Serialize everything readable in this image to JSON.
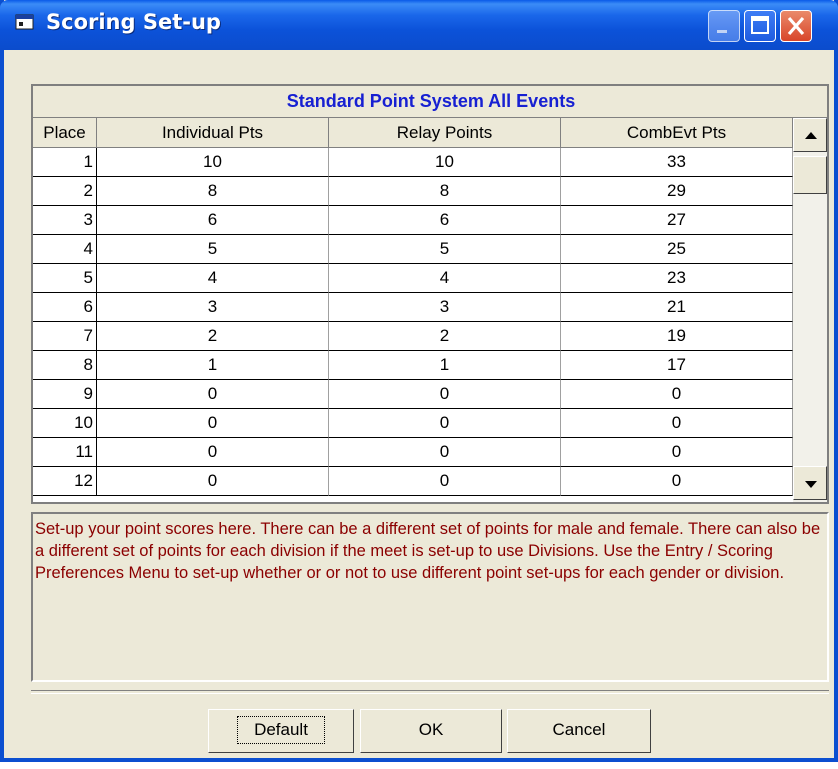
{
  "window": {
    "title": "Scoring Set-up"
  },
  "grid": {
    "caption": "Standard Point System All Events",
    "headers": [
      "Place",
      "Individual Pts",
      "Relay Points",
      "CombEvt Pts"
    ],
    "rows": [
      [
        "1",
        "10",
        "10",
        "33"
      ],
      [
        "2",
        "8",
        "8",
        "29"
      ],
      [
        "3",
        "6",
        "6",
        "27"
      ],
      [
        "4",
        "5",
        "5",
        "25"
      ],
      [
        "5",
        "4",
        "4",
        "23"
      ],
      [
        "6",
        "3",
        "3",
        "21"
      ],
      [
        "7",
        "2",
        "2",
        "19"
      ],
      [
        "8",
        "1",
        "1",
        "17"
      ],
      [
        "9",
        "0",
        "0",
        "0"
      ],
      [
        "10",
        "0",
        "0",
        "0"
      ],
      [
        "11",
        "0",
        "0",
        "0"
      ],
      [
        "12",
        "0",
        "0",
        "0"
      ]
    ]
  },
  "message": "Set-up your point scores here. There can be a different set of points for male and female. There can also be a different set of points for each division if the meet is set-up to use Divisions. Use the Entry / Scoring Preferences Menu to set-up whether or or not to use different point set-ups for each gender or division.",
  "buttons": {
    "default": "Default",
    "ok": "OK",
    "cancel": "Cancel"
  },
  "colors": {
    "title_bar": "#0b4fd0",
    "caption_text": "#1720d2",
    "message_text": "#8b0000",
    "face": "#ece9d8"
  },
  "icons": [
    "app-window-icon",
    "minimize-icon",
    "maximize-icon",
    "close-icon",
    "scroll-up-icon",
    "scroll-down-icon"
  ]
}
